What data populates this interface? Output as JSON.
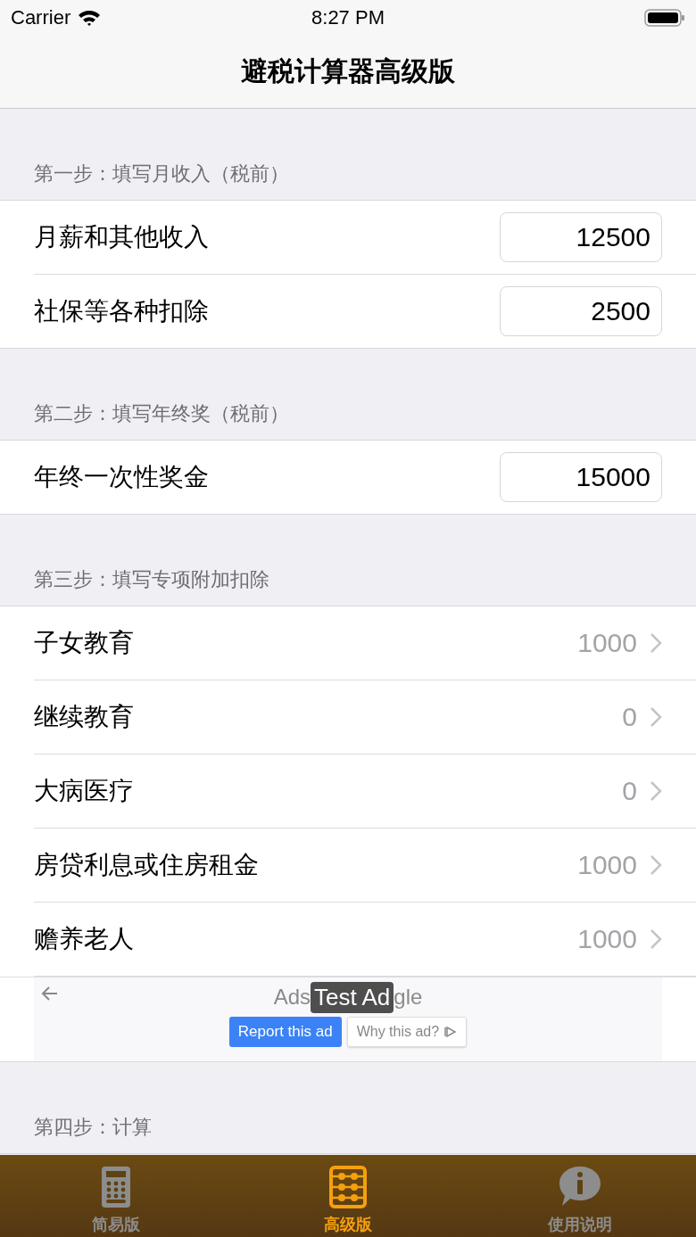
{
  "status_bar": {
    "carrier": "Carrier",
    "time": "8:27 PM"
  },
  "nav": {
    "title": "避税计算器高级版"
  },
  "sections": [
    {
      "header": "第一步：填写月收入（税前）",
      "rows": [
        {
          "kind": "input",
          "label": "月薪和其他收入",
          "value": "12500"
        },
        {
          "kind": "input",
          "label": "社保等各种扣除",
          "value": "2500"
        }
      ]
    },
    {
      "header": "第二步：填写年终奖（税前）",
      "rows": [
        {
          "kind": "input",
          "label": "年终一次性奖金",
          "value": "15000"
        }
      ]
    },
    {
      "header": "第三步：填写专项附加扣除",
      "rows": [
        {
          "kind": "disclosure",
          "label": "子女教育",
          "value": "1000"
        },
        {
          "kind": "disclosure",
          "label": "继续教育",
          "value": "0"
        },
        {
          "kind": "disclosure",
          "label": "大病医疗",
          "value": "0"
        },
        {
          "kind": "disclosure",
          "label": "房贷利息或住房租金",
          "value": "1000"
        },
        {
          "kind": "disclosure",
          "label": "赡养老人",
          "value": "1000"
        }
      ],
      "ad": {
        "label_left": "Ads",
        "label_right": "gle",
        "badge": "Test Ad",
        "report": "Report this ad",
        "why": "Why this ad?"
      }
    },
    {
      "header": "第四步：计算"
    }
  ],
  "tabs": [
    {
      "label": "简易版",
      "selected": false
    },
    {
      "label": "高级版",
      "selected": true
    },
    {
      "label": "使用说明",
      "selected": false
    }
  ]
}
